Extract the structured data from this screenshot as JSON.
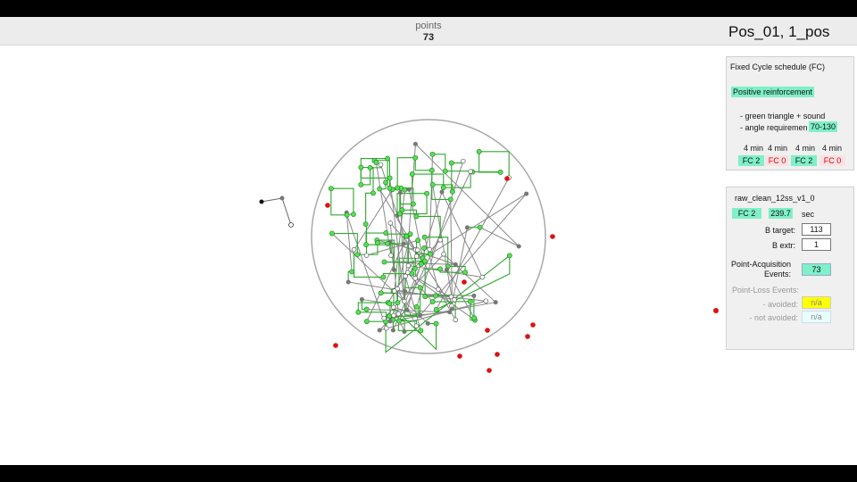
{
  "header": {
    "points_label": "points",
    "points_value": "73",
    "title": "Pos_01, 1_pos"
  },
  "schedule_panel": {
    "heading": "Fixed Cycle schedule (FC)",
    "reinforcement": "Positive reinforcement",
    "line1": "- green triangle + sound",
    "line2_label": "- angle requiremen",
    "angle_value": "70-130",
    "durations": [
      "4 min",
      "4 min",
      "4 min",
      "4 min"
    ],
    "cycles": [
      "FC 2",
      "FC 0",
      "FC 2",
      "FC 0"
    ]
  },
  "session_panel": {
    "file": "raw_clean_12ss_v1_0",
    "current_cycle": "FC 2",
    "time_value": "239.7",
    "time_unit": "sec",
    "b_target_label": "B target:",
    "b_target_value": "113",
    "b_extr_label": "B extr:",
    "b_extr_value": "1",
    "acq_label_1": "Point-Acquisition",
    "acq_label_2": "Events:",
    "acq_value": "73",
    "loss_label": "Point-Loss Events:",
    "avoided_label": "- avoided:",
    "avoided_value": "n/a",
    "not_avoided_label": "- not avoided:",
    "not_avoided_value": "n/a"
  },
  "colors": {
    "accent_green": "#7ff0c8",
    "reward_dot": "#55e055",
    "path_green": "#2fa82f",
    "target_red": "#dd1111",
    "avoided_yellow": "#ffff00"
  }
}
